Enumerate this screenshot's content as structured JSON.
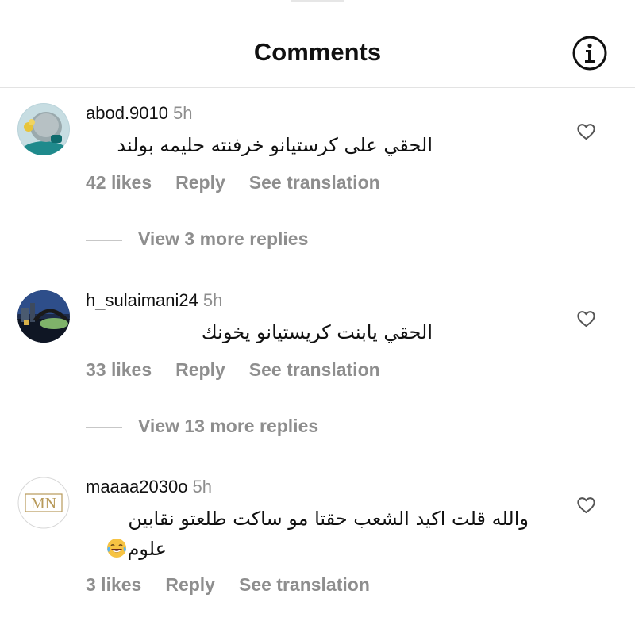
{
  "header": {
    "title": "Comments"
  },
  "comments": [
    {
      "username": "abod.9010",
      "time": "5h",
      "text": "الحقي على كرستيانو خرفنته حليمه بولند",
      "likes": "42 likes",
      "reply": "Reply",
      "translate": "See translation",
      "view_replies": "View 3 more replies"
    },
    {
      "username": "h_sulaimani24",
      "time": "5h",
      "text": "الحقي يابنت كريستيانو يخونك",
      "likes": "33 likes",
      "reply": "Reply",
      "translate": "See translation",
      "view_replies": "View 13 more replies"
    },
    {
      "username": "maaaa2030o",
      "time": "5h",
      "text_line1": "والله قلت اكيد الشعب حقتا مو ساكت طلعتو نقابين",
      "text_line2": "علوم",
      "avatar_logo": "MN",
      "likes": "3 likes",
      "reply": "Reply",
      "translate": "See translation"
    }
  ],
  "icons": {
    "info": "info-icon",
    "like": "heart-outline-icon",
    "emoji": "face-with-tears-of-joy-emoji"
  },
  "colors": {
    "secondary_text": "#8e8e8e",
    "primary_text": "#111111",
    "divider": "#e3e3e3"
  }
}
